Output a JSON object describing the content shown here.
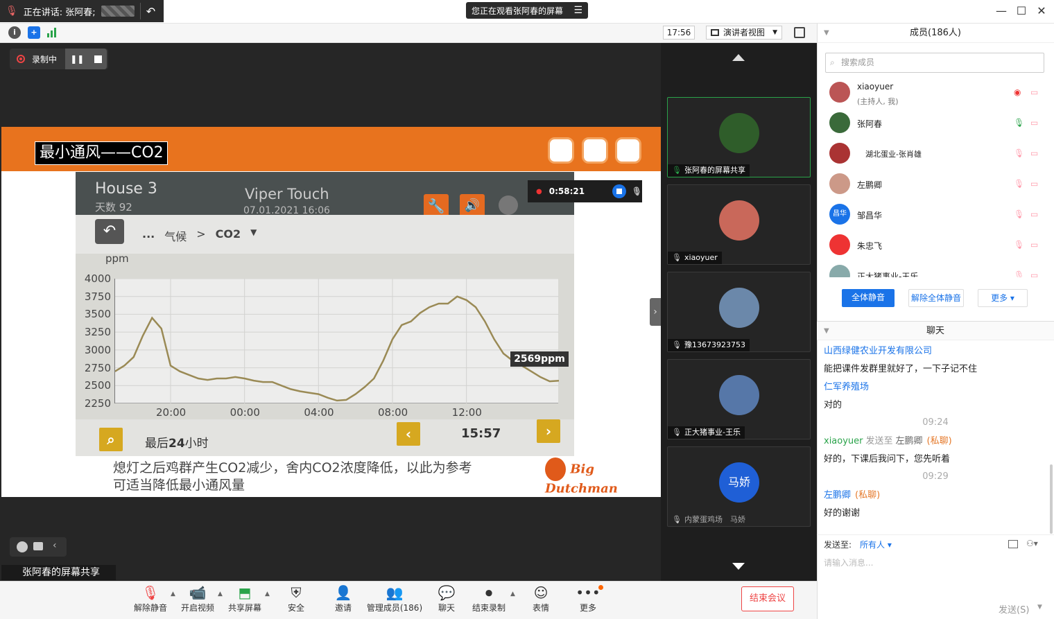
{
  "titlebar": {
    "speaking_label": "正在讲话: 张阿春;",
    "watching_label": "您正在观看张阿春的屏幕",
    "window_min": "—",
    "window_max": "☐",
    "window_close": "✕"
  },
  "subbar": {
    "clock": "17:56",
    "view_mode": "演讲者视图"
  },
  "recording": {
    "label": "录制中"
  },
  "slide": {
    "title": "最小通风——CO2",
    "device": {
      "house": "House 3",
      "days": "天数 92",
      "product": "Viper Touch",
      "datetime": "07.01.2021 16:06",
      "breadcrumb_dots": "...",
      "breadcrumb_1": "气候",
      "breadcrumb_sep": ">",
      "breadcrumb_2": "CO2",
      "yunit": "ppm",
      "range_label_prefix": "最后",
      "range_label_num": "24",
      "range_label_suffix": "小时",
      "time": "15:57",
      "tooltip": "2569ppm"
    },
    "caption_1": "熄灯之后鸡群产生CO2减少，舍内CO2浓度降低，以此为参考",
    "caption_2": "可适当降低最小通风量",
    "logo_text": "Big Dutchman",
    "timer": "0:58:21"
  },
  "share_label": "张阿春的屏幕共享",
  "chart_data": {
    "type": "line",
    "title": "",
    "xlabel": "",
    "ylabel": "ppm",
    "ylim": [
      2250,
      4000
    ],
    "yticks": [
      4000,
      3750,
      3500,
      3250,
      3000,
      2750,
      2500,
      2250
    ],
    "xticks": [
      "20:00",
      "00:00",
      "04:00",
      "08:00",
      "12:00"
    ],
    "x_hours_from_start": [
      0,
      0.5,
      1,
      1.5,
      2,
      2.5,
      3,
      3.5,
      4,
      4.5,
      5,
      5.5,
      6,
      6.5,
      7,
      7.5,
      8,
      8.5,
      9,
      9.5,
      10,
      10.5,
      11,
      11.5,
      12,
      12.5,
      13,
      13.5,
      14,
      14.5,
      15,
      15.5,
      16,
      16.5,
      17,
      17.5,
      18,
      18.5,
      19,
      19.5,
      20,
      20.5,
      21,
      21.5,
      22,
      22.5,
      23,
      23.5,
      24
    ],
    "series": [
      {
        "values": [
          2700,
          2780,
          2900,
          3200,
          3450,
          3300,
          2780,
          2700,
          2650,
          2600,
          2580,
          2600,
          2600,
          2620,
          2600,
          2570,
          2550,
          2550,
          2500,
          2450,
          2420,
          2400,
          2380,
          2330,
          2290,
          2300,
          2380,
          2480,
          2600,
          2850,
          3150,
          3350,
          3400,
          3520,
          3600,
          3650,
          3650,
          3750,
          3700,
          3600,
          3400,
          3150,
          2950,
          2850,
          2780,
          2700,
          2620,
          2560,
          2569
        ]
      }
    ]
  },
  "video_tiles": [
    {
      "label": "张阿春的屏幕共享"
    },
    {
      "label": "xiaoyuer"
    },
    {
      "label": "豫13673923753"
    },
    {
      "label": "正大猪事业-王乐"
    },
    {
      "label": "内蒙蛋鸡场　马娇",
      "avatar_text": "马娇"
    }
  ],
  "toolbar": {
    "unmute": "解除静音",
    "video": "开启视频",
    "share": "共享屏幕",
    "security": "安全",
    "invite": "邀请",
    "members": "管理成员(186)",
    "chat": "聊天",
    "stop_rec": "结束录制",
    "reaction": "表情",
    "more": "更多",
    "end": "结束会议"
  },
  "members": {
    "header": "成员(186人)",
    "search_placeholder": "搜索成员",
    "list": [
      {
        "name": "xiaoyuer",
        "sub": "(主持人, 我)"
      },
      {
        "name": "张阿春",
        "sub": ""
      },
      {
        "name": "湖北蛋业-张肖雄",
        "sub": ""
      },
      {
        "name": "左鹏卿",
        "sub": ""
      },
      {
        "name": "邹昌华",
        "sub": "",
        "avatar_text": "昌华"
      },
      {
        "name": "朱忠飞",
        "sub": ""
      },
      {
        "name": "正大猪事业-王乐",
        "sub": ""
      }
    ],
    "mute_all": "全体静音",
    "unmute_all": "解除全体静音",
    "more": "更多 ▾"
  },
  "chat": {
    "header": "聊天",
    "messages": [
      {
        "from": "山西绿健农业开发有限公司",
        "text": "能把课件发群里就好了，一下子记不住"
      },
      {
        "from": "仁军养殖场",
        "text": "对的"
      },
      {
        "time": "09:24"
      },
      {
        "from": "xiaoyuer",
        "to_prefix": "发送至",
        "to": "左鹏卿",
        "private": "(私聊)",
        "text": "好的，下课后我问下，您先听着"
      },
      {
        "time": "09:29"
      },
      {
        "from": "左鹏卿",
        "private": "(私聊)",
        "text": "好的谢谢"
      }
    ],
    "send_to_label": "发送至:",
    "send_to_value": "所有人 ▾",
    "input_placeholder": "请输入消息...",
    "send_button": "发送(S)"
  }
}
